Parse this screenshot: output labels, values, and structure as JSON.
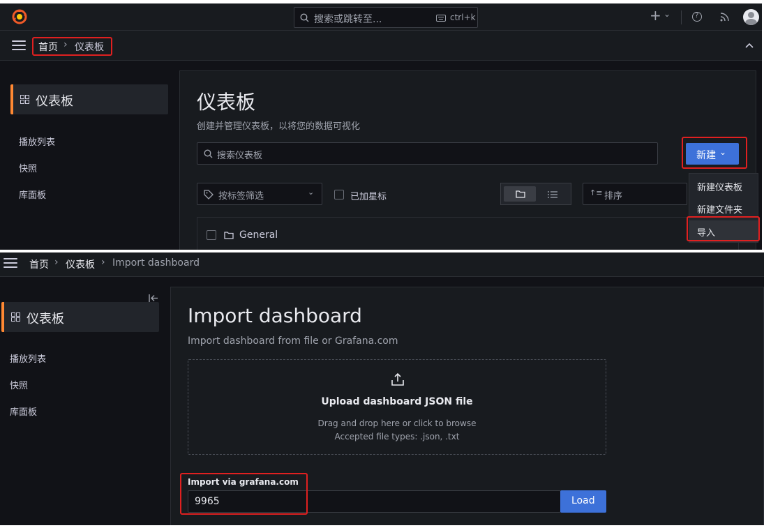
{
  "top": {
    "search_placeholder": "搜索或跳转至...",
    "shortcut": "ctrl+k",
    "plus": "+",
    "plus_chevron": "⌄",
    "help": "?"
  },
  "breadcrumb1": {
    "home": "首页",
    "sep": "›",
    "current": "仪表板"
  },
  "sidebar": {
    "active": "仪表板",
    "items": [
      "播放列表",
      "快照",
      "库面板"
    ]
  },
  "dashboards": {
    "title": "仪表板",
    "subtitle": "创建并管理仪表板，以将您的数据可视化",
    "search_placeholder": "搜索仪表板",
    "new_button": "新建",
    "new_chevron": "⌄",
    "tag_filter": "按标签筛选",
    "tag_chevron": "⌄",
    "starred": "已加星标",
    "sort": "排序",
    "sort_icon": "↑≡",
    "folder_row": "General",
    "menu": [
      "新建仪表板",
      "新建文件夹",
      "导入"
    ]
  },
  "breadcrumb2": {
    "home": "首页",
    "sep1": "›",
    "mid": "仪表板",
    "sep2": "›",
    "current": "Import dashboard"
  },
  "import": {
    "title": "Import dashboard",
    "subtitle": "Import dashboard from file or Grafana.com",
    "upload_title": "Upload dashboard JSON file",
    "upload_hint1": "Drag and drop here or click to browse",
    "upload_hint2": "Accepted file types: .json, .txt",
    "via_label": "Import via grafana.com",
    "via_value": "9965",
    "load_button": "Load"
  },
  "colors": {
    "accent": "#ff8833",
    "primary": "#3d71d9",
    "highlight": "#e02020",
    "background": "#111217"
  }
}
